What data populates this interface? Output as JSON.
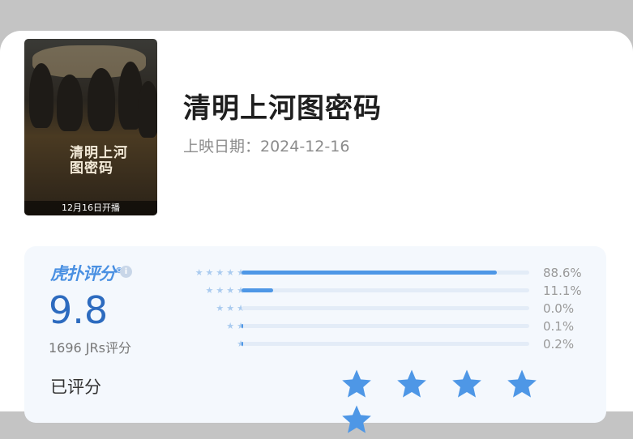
{
  "show": {
    "title": "清明上河图密码",
    "release": "上映日期：2024-12-16",
    "poster": {
      "title_text": "清明上河图密码",
      "date_text": "12月16日开播"
    }
  },
  "rating": {
    "brand": "虎扑评分",
    "brand_mark": "®",
    "info_icon": "i",
    "score": "9.8",
    "count": "1696 JRs评分",
    "distribution": [
      {
        "stars": "★★★★★",
        "percent": "88.6%",
        "value": 88.6
      },
      {
        "stars": "★★★★",
        "percent": "11.1%",
        "value": 11.1
      },
      {
        "stars": "★★★",
        "percent": "0.0%",
        "value": 0.0
      },
      {
        "stars": "★★",
        "percent": "0.1%",
        "value": 0.1
      },
      {
        "stars": "★",
        "percent": "0.2%",
        "value": 0.2
      }
    ],
    "rated_label": "已评分",
    "user_stars": 5,
    "star_color": "#4e97e6"
  }
}
